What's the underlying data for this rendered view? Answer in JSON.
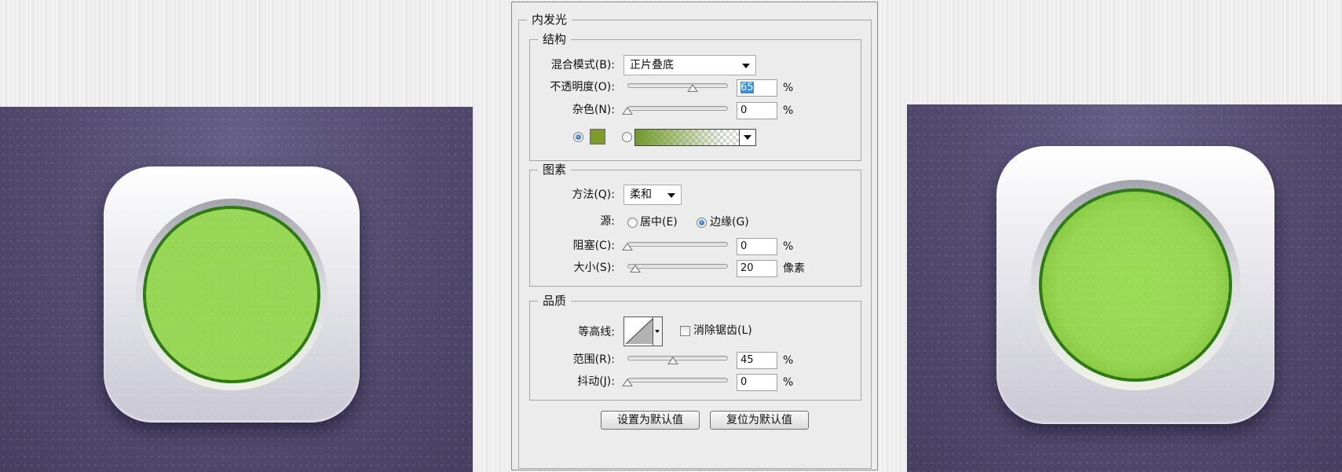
{
  "dialog": {
    "title": "内发光",
    "structure": {
      "legend": "结构",
      "blend_mode_label": "混合模式(B):",
      "blend_mode_value": "正片叠底",
      "opacity_label": "不透明度(O):",
      "opacity_value": "65",
      "opacity_unit": "%",
      "opacity_slider": 0.65,
      "noise_label": "杂色(N):",
      "noise_value": "0",
      "noise_unit": "%",
      "noise_slider": 0,
      "color_swatch": "#7d9a2a",
      "solid_color_selected": true
    },
    "elements": {
      "legend": "图素",
      "technique_label": "方法(Q):",
      "technique_value": "柔和",
      "source_label": "源:",
      "source_center": "居中(E)",
      "source_edge": "边缘(G)",
      "source_selected": "edge",
      "choke_label": "阻塞(C):",
      "choke_value": "0",
      "choke_unit": "%",
      "choke_slider": 0,
      "size_label": "大小(S):",
      "size_value": "20",
      "size_unit": "像素",
      "size_slider": 0.08
    },
    "quality": {
      "legend": "品质",
      "contour_label": "等高线:",
      "antialias_label": "消除锯齿(L)",
      "antialias_checked": false,
      "range_label": "范围(R):",
      "range_value": "45",
      "range_unit": "%",
      "range_slider": 0.45,
      "jitter_label": "抖动(J):",
      "jitter_value": "0",
      "jitter_unit": "%",
      "jitter_slider": 0
    },
    "buttons": {
      "make_default": "设置为默认值",
      "reset_default": "复位为默认值"
    }
  },
  "colors": {
    "preview_background": "#524b6e",
    "button_green": "#98d655",
    "button_border": "#2c7a12"
  }
}
